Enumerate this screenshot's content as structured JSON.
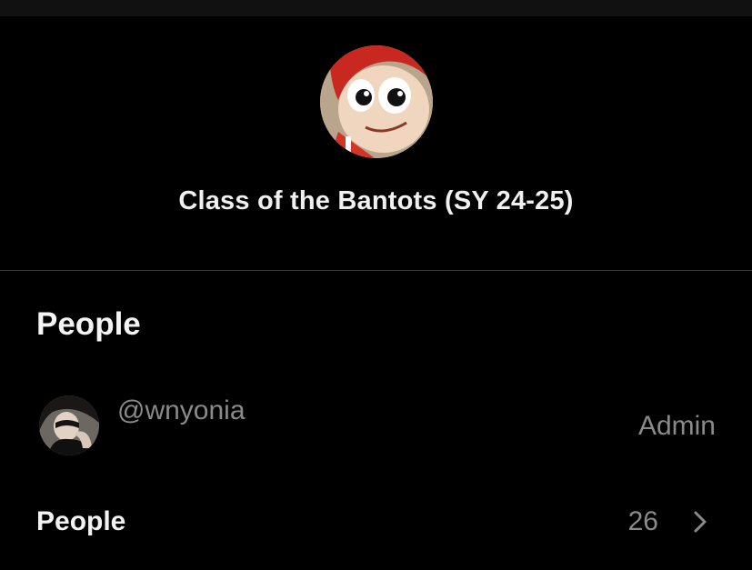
{
  "group": {
    "title": "Class of the Bantots (SY 24-25)",
    "avatar_icon": "mascot-photo"
  },
  "people_section": {
    "heading": "People",
    "members": [
      {
        "handle": "@wnyonia",
        "role": "Admin",
        "avatar_icon": "user-photo"
      }
    ],
    "summary": {
      "label": "People",
      "count": "26",
      "chevron_icon": "chevron-right-icon"
    }
  },
  "colors": {
    "background": "#000000",
    "primary_text": "#f2f2f2",
    "secondary_text": "#8a8a8a",
    "divider": "#3a3a3a"
  }
}
